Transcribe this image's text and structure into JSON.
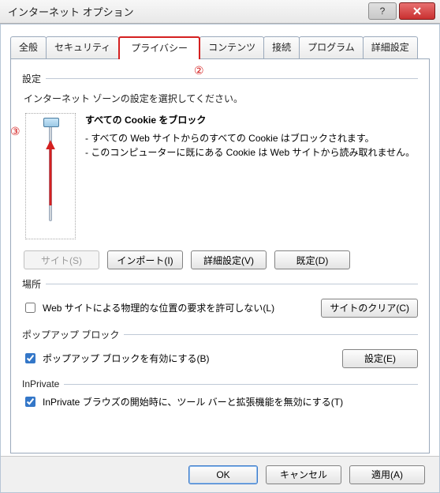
{
  "window": {
    "title": "インターネット オプション"
  },
  "tabs": {
    "general": "全般",
    "security": "セキュリティ",
    "privacy": "プライバシー",
    "content": "コンテンツ",
    "connections": "接続",
    "programs": "プログラム",
    "advanced": "詳細設定"
  },
  "callouts": {
    "two": "②",
    "three": "③"
  },
  "settings": {
    "group_label": "設定",
    "instruction": "インターネット ゾーンの設定を選択してください。",
    "policy_title": "すべての Cookie をブロック",
    "policy_line1": "- すべての Web サイトからのすべての Cookie はブロックされます。",
    "policy_line2": "- このコンピューターに既にある Cookie は Web サイトから読み取れません。",
    "sites_btn": "サイト(S)",
    "import_btn": "インポート(I)",
    "adv_btn": "詳細設定(V)",
    "default_btn": "既定(D)"
  },
  "location": {
    "group_label": "場所",
    "checkbox_label": "Web サイトによる物理的な位置の要求を許可しない(L)",
    "clear_btn": "サイトのクリア(C)"
  },
  "popup": {
    "group_label": "ポップアップ ブロック",
    "checkbox_label": "ポップアップ ブロックを有効にする(B)",
    "settings_btn": "設定(E)"
  },
  "inprivate": {
    "group_label": "InPrivate",
    "checkbox_label": "InPrivate ブラウズの開始時に、ツール バーと拡張機能を無効にする(T)"
  },
  "dialog_buttons": {
    "ok": "OK",
    "cancel": "キャンセル",
    "apply": "適用(A)"
  }
}
